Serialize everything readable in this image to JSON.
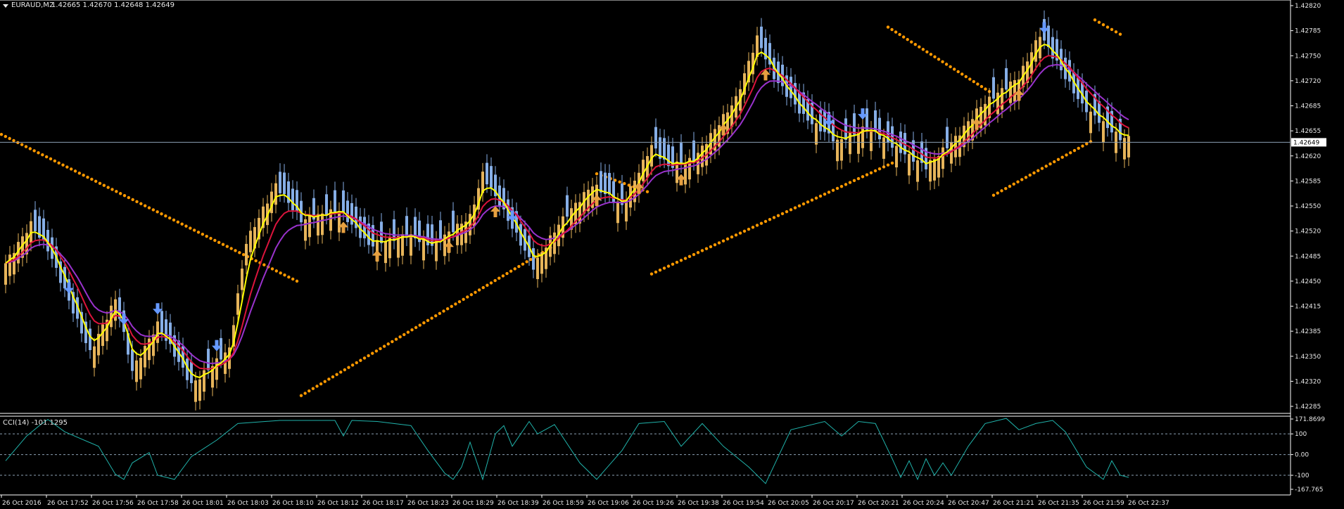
{
  "main_header": {
    "symbol": "EURAUD,M2",
    "ohlc": "1.42665 1.42670 1.42648 1.42649"
  },
  "cci_header": "CCI(14) -101.1295",
  "colors": {
    "background": "#000000",
    "axis": "#ffffff",
    "bull": "#e6b45a",
    "bear": "#86aee6",
    "ma_fast": "#ffff00",
    "ma_mid": "#dc143c",
    "ma_slow": "#9932cc",
    "dots": "#ff9900",
    "cci": "#20b2aa",
    "level_line": "#8ca0b4",
    "arrow_up": "#e6a040",
    "arrow_down": "#6699ff"
  },
  "chart_data": [
    {
      "type": "candlestick",
      "title": "EURAUD,M2",
      "ylim": [
        1.4228,
        1.4284
      ],
      "y_ticks": [
        "1.42820",
        "1.42785",
        "1.42750",
        "1.42720",
        "1.42685",
        "1.42655",
        "1.42620",
        "1.42585",
        "1.42550",
        "1.42520",
        "1.42485",
        "1.42450",
        "1.42415",
        "1.42385",
        "1.42350",
        "1.42320",
        "1.42285"
      ],
      "current_price": "1.42649",
      "x_ticks": [
        "26 Oct 2016",
        "26 Oct 17:52",
        "26 Oct 17:56",
        "26 Oct 17:58",
        "26 Oct 18:01",
        "26 Oct 18:03",
        "26 Oct 18:10",
        "26 Oct 18:12",
        "26 Oct 18:17",
        "26 Oct 18:23",
        "26 Oct 18:29",
        "26 Oct 18:39",
        "26 Oct 18:59",
        "26 Oct 19:06",
        "26 Oct 19:26",
        "26 Oct 19:38",
        "26 Oct 19:54",
        "26 Oct 20:05",
        "26 Oct 20:17",
        "26 Oct 20:21",
        "26 Oct 20:24",
        "26 Oct 20:47",
        "26 Oct 21:21",
        "26 Oct 21:35",
        "26 Oct 21:59",
        "26 Oct 22:37"
      ],
      "close_path": [
        [
          0,
          1.4248
        ],
        [
          6,
          1.42535
        ],
        [
          10,
          1.425
        ],
        [
          20,
          1.42355
        ],
        [
          26,
          1.4243
        ],
        [
          30,
          1.4233
        ],
        [
          36,
          1.42395
        ],
        [
          44,
          1.4231
        ],
        [
          53,
          1.4236
        ],
        [
          57,
          1.4251
        ],
        [
          64,
          1.4259
        ],
        [
          70,
          1.4254
        ],
        [
          79,
          1.42555
        ],
        [
          86,
          1.42505
        ],
        [
          95,
          1.4252
        ],
        [
          101,
          1.42505
        ],
        [
          110,
          1.42545
        ],
        [
          113,
          1.42605
        ],
        [
          120,
          1.4253
        ],
        [
          125,
          1.42475
        ],
        [
          131,
          1.42535
        ],
        [
          139,
          1.4259
        ],
        [
          146,
          1.4256
        ],
        [
          153,
          1.42645
        ],
        [
          157,
          1.42615
        ],
        [
          163,
          1.42625
        ],
        [
          173,
          1.4271
        ],
        [
          178,
          1.42795
        ],
        [
          182,
          1.4274
        ],
        [
          189,
          1.42685
        ],
        [
          197,
          1.4265
        ],
        [
          204,
          1.4267
        ],
        [
          211,
          1.4264
        ],
        [
          218,
          1.42615
        ],
        [
          225,
          1.42655
        ],
        [
          231,
          1.427
        ],
        [
          240,
          1.4274
        ],
        [
          245,
          1.428
        ],
        [
          255,
          1.427
        ],
        [
          264,
          1.42655
        ]
      ],
      "moving_averages": [
        "fast",
        "mid",
        "slow"
      ],
      "signals_up": [
        80,
        88,
        105,
        116,
        140,
        150,
        160,
        170,
        180,
        230,
        240
      ],
      "signals_down": [
        15,
        28,
        36,
        50,
        120,
        195,
        203,
        246
      ],
      "dotted_lines": [
        {
          "from": [
            -1,
            1.4266
          ],
          "to": [
            69,
            1.42455
          ]
        },
        {
          "from": [
            70,
            1.42295
          ],
          "to": [
            130,
            1.42505
          ]
        },
        {
          "from": [
            140,
            1.42605
          ],
          "to": [
            152,
            1.4258
          ]
        },
        {
          "from": [
            153,
            1.42465
          ],
          "to": [
            210,
            1.4262
          ]
        },
        {
          "from": [
            209,
            1.4281
          ],
          "to": [
            233,
            1.4272
          ]
        },
        {
          "from": [
            234,
            1.42575
          ],
          "to": [
            257,
            1.4265
          ]
        },
        {
          "from": [
            258,
            1.4282
          ],
          "to": [
            264,
            1.428
          ]
        }
      ]
    },
    {
      "type": "line",
      "title": "CCI(14) -101.1295",
      "ylim": [
        -167.765,
        171.8699
      ],
      "y_ticks": [
        "171.8699",
        "100",
        "0.00",
        "-100",
        "-167.765"
      ],
      "levels": [
        100,
        0,
        -100
      ],
      "series": [
        {
          "points": [
            [
              0,
              -30
            ],
            [
              5,
              90
            ],
            [
              8,
              140
            ],
            [
              10,
              170
            ],
            [
              14,
              110
            ],
            [
              22,
              40
            ],
            [
              26,
              -95
            ],
            [
              28,
              -120
            ],
            [
              30,
              -40
            ],
            [
              34,
              10
            ],
            [
              36,
              -100
            ],
            [
              40,
              -120
            ],
            [
              44,
              -10
            ],
            [
              50,
              70
            ],
            [
              55,
              150
            ],
            [
              65,
              165
            ],
            [
              70,
              165
            ],
            [
              78,
              165
            ],
            [
              80,
              90
            ],
            [
              82,
              165
            ],
            [
              88,
              160
            ],
            [
              96,
              140
            ],
            [
              100,
              20
            ],
            [
              104,
              -90
            ],
            [
              106,
              -120
            ],
            [
              108,
              -60
            ],
            [
              110,
              60
            ],
            [
              113,
              -120
            ],
            [
              116,
              100
            ],
            [
              118,
              140
            ],
            [
              120,
              40
            ],
            [
              124,
              160
            ],
            [
              126,
              100
            ],
            [
              130,
              145
            ],
            [
              136,
              -40
            ],
            [
              140,
              -120
            ],
            [
              146,
              20
            ],
            [
              150,
              150
            ],
            [
              156,
              160
            ],
            [
              160,
              40
            ],
            [
              165,
              150
            ],
            [
              170,
              40
            ],
            [
              176,
              -60
            ],
            [
              180,
              -140
            ],
            [
              186,
              120
            ],
            [
              194,
              160
            ],
            [
              198,
              90
            ],
            [
              202,
              160
            ],
            [
              206,
              150
            ],
            [
              210,
              -20
            ],
            [
              212,
              -110
            ],
            [
              214,
              -30
            ],
            [
              216,
              -120
            ],
            [
              218,
              -20
            ],
            [
              220,
              -100
            ],
            [
              222,
              -40
            ],
            [
              224,
              -100
            ],
            [
              228,
              40
            ],
            [
              232,
              150
            ],
            [
              237,
              175
            ],
            [
              240,
              120
            ],
            [
              244,
              150
            ],
            [
              248,
              165
            ],
            [
              251,
              110
            ],
            [
              256,
              -60
            ],
            [
              260,
              -120
            ],
            [
              262,
              -30
            ],
            [
              264,
              -100
            ],
            [
              266,
              -110
            ]
          ]
        }
      ]
    }
  ]
}
